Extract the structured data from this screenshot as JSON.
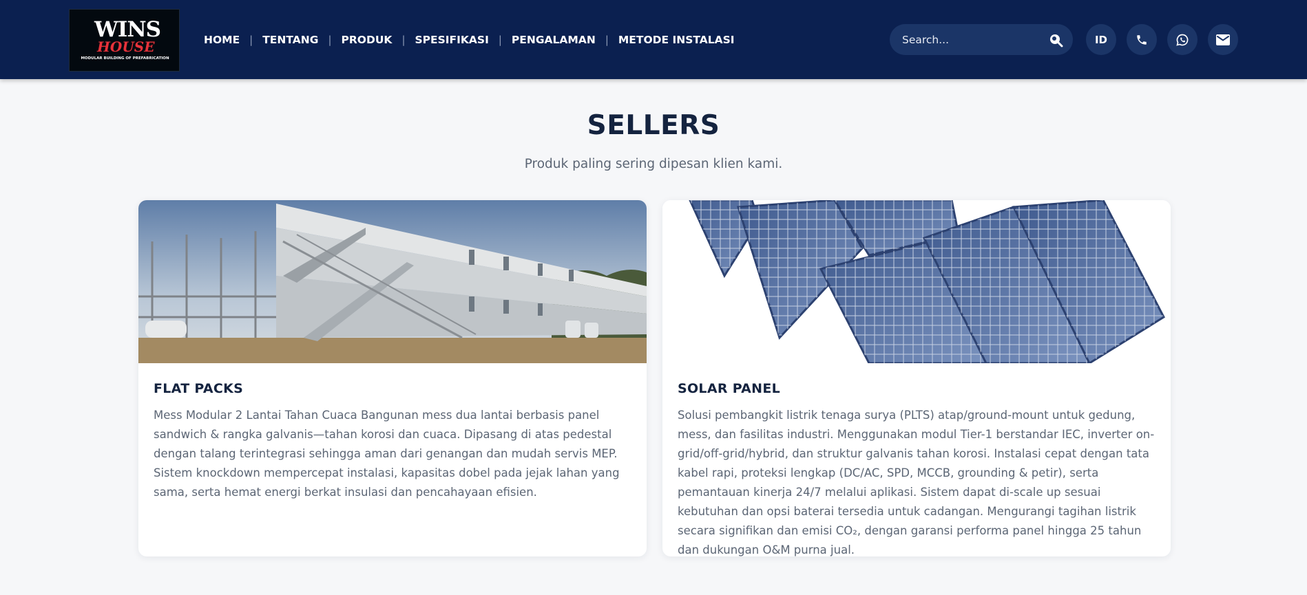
{
  "brand": {
    "logo_main": "WINS",
    "logo_sub": "HOUSE",
    "logo_tagline": "MODULAR BUILDING OF PREFABRICATION"
  },
  "nav": {
    "items": [
      {
        "label": "HOME"
      },
      {
        "label": "TENTANG"
      },
      {
        "label": "PRODUK"
      },
      {
        "label": "SPESIFIKASI"
      },
      {
        "label": "PENGALAMAN"
      },
      {
        "label": "METODE INSTALASI"
      }
    ],
    "separator": "|"
  },
  "search": {
    "placeholder": "Search...",
    "value": "",
    "icon": "search-icon"
  },
  "actions": {
    "language_label": "ID",
    "phone_icon": "phone-icon",
    "whatsapp_icon": "whatsapp-icon",
    "email_icon": "email-icon"
  },
  "section": {
    "title": "SELLERS",
    "subtitle": "Produk paling sering dipesan klien kami."
  },
  "products": [
    {
      "title": "FLAT PACKS",
      "description": "Mess Modular 2 Lantai Tahan Cuaca Bangunan mess dua lantai berbasis panel sandwich & rangka galvanis—tahan korosi dan cuaca. Dipasang di atas pedestal dengan talang terintegrasi sehingga aman dari genangan dan mudah servis MEP. Sistem knockdown mempercepat instalasi, kapasitas dobel pada jejak lahan yang sama, serta hemat energi berkat insulasi dan pencahayaan efisien."
    },
    {
      "title": "SOLAR PANEL",
      "description": "Solusi pembangkit listrik tenaga surya (PLTS) atap/ground-mount untuk gedung, mess, dan fasilitas industri. Menggunakan modul Tier-1 berstandar IEC, inverter on-grid/off-grid/hybrid, dan struktur galvanis tahan korosi. Instalasi cepat dengan tata kabel rapi, proteksi lengkap (DC/AC, SPD, MCCB, grounding & petir), serta pemantauan kinerja 24/7 melalui aplikasi. Sistem dapat di-scale up sesuai kebutuhan dan opsi baterai tersedia untuk cadangan. Mengurangi tagihan listrik secara signifikan dan emisi CO₂, dengan garansi performa panel hingga 25 tahun dan dukungan O&M purna jual."
    }
  ],
  "colors": {
    "header_bg": "#0b2050",
    "pill_bg": "#1b3567",
    "page_bg": "#f6f7f9",
    "heading": "#14233f",
    "body_text": "#5c6675"
  }
}
